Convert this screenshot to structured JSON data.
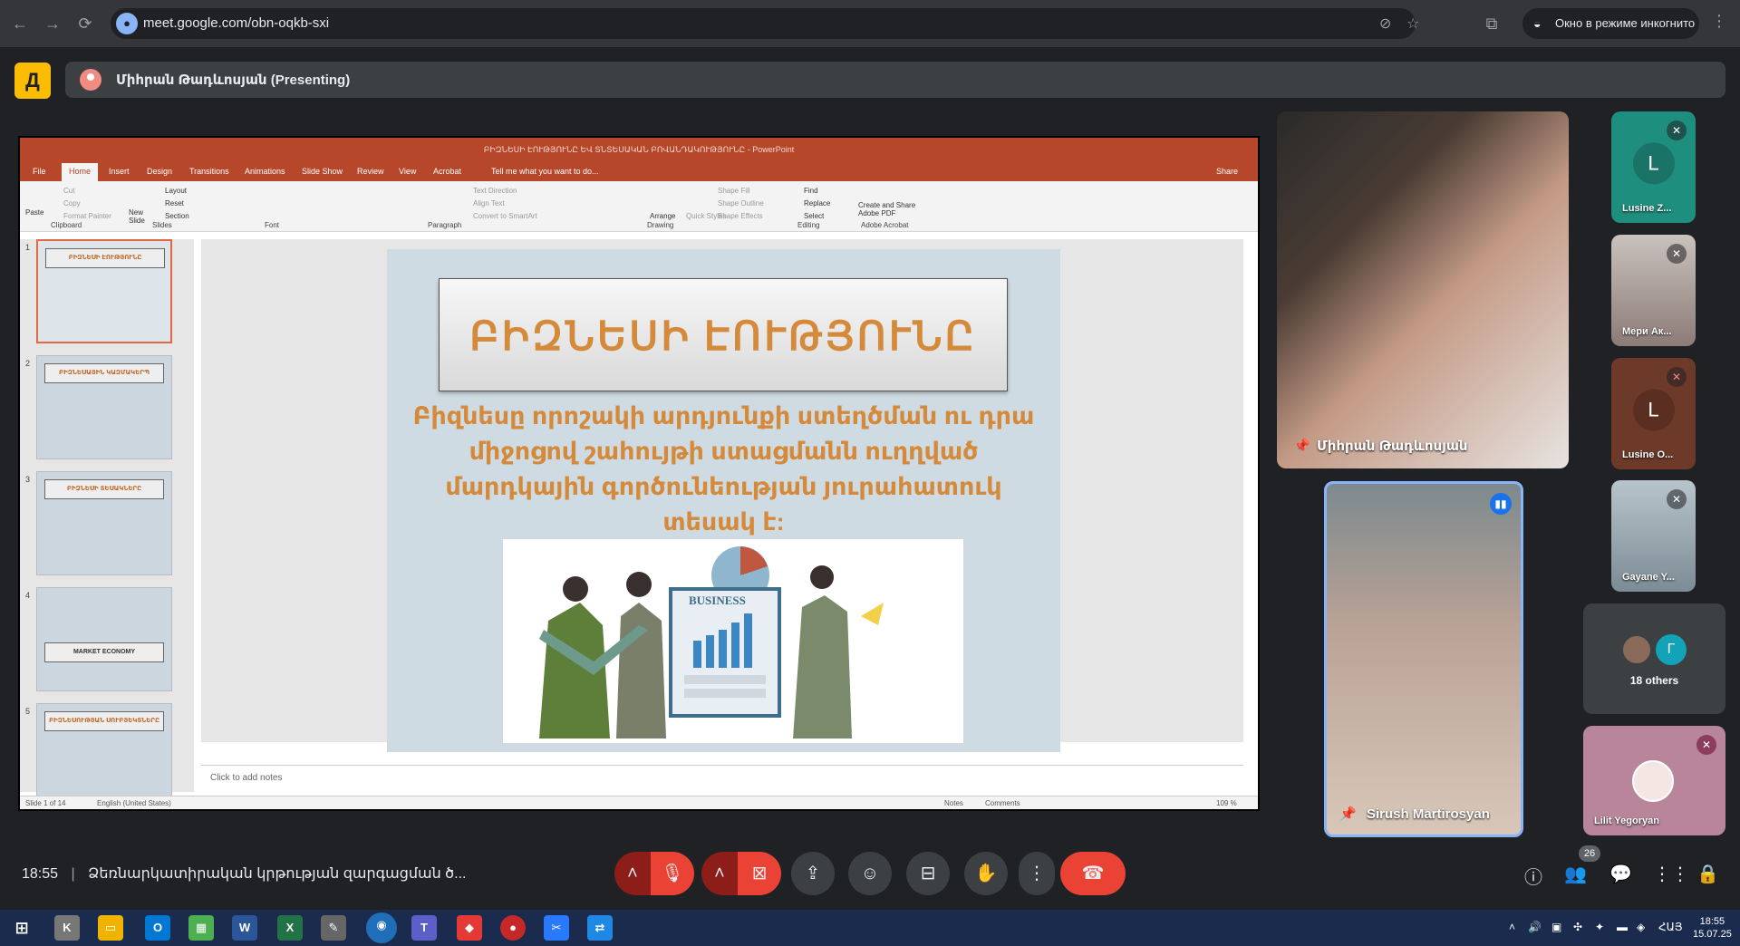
{
  "browser": {
    "url": "meet.google.com/obn-oqkb-sxi",
    "incognito_label": "Окно в режиме инкогнито"
  },
  "meet": {
    "presenting_label": "Միհրան Թադևոսյան (Presenting)",
    "time": "18:55",
    "meeting_title": "Ձեռնարկատիրական կրթության զարգացման ծ...",
    "participant_count": "26",
    "others_label": "18 others"
  },
  "ppt": {
    "window_title": "ԲԻԶՆԵՍԻ ԷՈՒԹՅՈՒՆԸ ԵՎ ՏՆՏԵՍԱԿԱՆ ԲՈՎԱՆԴԱԿՈՒԹՅՈՒՆԸ - PowerPoint",
    "tabs": [
      "File",
      "Home",
      "Insert",
      "Design",
      "Transitions",
      "Animations",
      "Slide Show",
      "Review",
      "View",
      "Acrobat"
    ],
    "tell_me": "Tell me what you want to do...",
    "share": "Share",
    "ribbon": {
      "paste": "Paste",
      "cut": "Cut",
      "copy": "Copy",
      "format_painter": "Format Painter",
      "clipboard": "Clipboard",
      "new_slide": "New Slide",
      "layout": "Layout",
      "reset": "Reset",
      "section": "Section",
      "slides": "Slides",
      "font": "Font",
      "text_direction": "Text Direction",
      "align_text": "Align Text",
      "convert_smartart": "Convert to SmartArt",
      "paragraph": "Paragraph",
      "arrange": "Arrange",
      "quick_styles": "Quick Styles",
      "shape_fill": "Shape Fill",
      "shape_outline": "Shape Outline",
      "shape_effects": "Shape Effects",
      "drawing": "Drawing",
      "find": "Find",
      "replace": "Replace",
      "select": "Select",
      "editing": "Editing",
      "adobe_pdf": "Create and Share Adobe PDF",
      "adobe_acrobat": "Adobe Acrobat"
    },
    "thumbnails": [
      {
        "num": "1",
        "title": "ԲԻԶՆԵՍԻ ԷՈՒԹՅՈՒՆԸ"
      },
      {
        "num": "2",
        "title": "ԲԻԶՆԵՍԱՅԻՆ ԿԱԶՄԱԿԵՐՊ"
      },
      {
        "num": "3",
        "title": "ԲԻԶՆԵՍԻ ՏԵՍԱԿՆԵՐԸ"
      },
      {
        "num": "4",
        "title": "MARKET ECONOMY"
      },
      {
        "num": "5",
        "title": "ԲԻԶՆԵՍՈՒԹՅԱՆ ՍՈՒԲՅԵԿՏՆԵՐԸ"
      }
    ],
    "slide_title": "ԲԻԶՆԵՍԻ ԷՈՒԹՅՈՒՆԸ",
    "slide_body": "Բիզնեսը որոշակի արդյունքի ստեղծման ու դրա միջոցով շահույթի ստացմանն ուղղված մարդկային գործունեության յուրահատուկ տեսակ է:",
    "image_label": "BUSINESS",
    "notes_placeholder": "Click to add notes",
    "status_slide": "Slide 1 of 14",
    "status_lang": "English (United States)",
    "status_notes": "Notes",
    "status_comments": "Comments",
    "zoom": "109 %"
  },
  "participants": {
    "main_presenter": "Միհրան Թադևոսյան",
    "speaker": "Sirush Martirosyan",
    "side": [
      {
        "name": "Lusine Z...",
        "letter": "L",
        "color": "#1e8e7e"
      },
      {
        "name": "Мери Ак...",
        "letter": "",
        "color": "#9c8f8c"
      },
      {
        "name": "Lusine O...",
        "letter": "L",
        "color": "#6d3a2a"
      },
      {
        "name": "Gayane Y...",
        "letter": "",
        "color": "#8fa3ae"
      },
      {
        "name": "Lilit Yegoryan",
        "letter": "",
        "color": "#b9859a"
      }
    ],
    "others_avatar_letter": "Г"
  },
  "taskbar": {
    "lang": "ՀԱՅ",
    "time": "18:55",
    "date": "15.07.25"
  }
}
